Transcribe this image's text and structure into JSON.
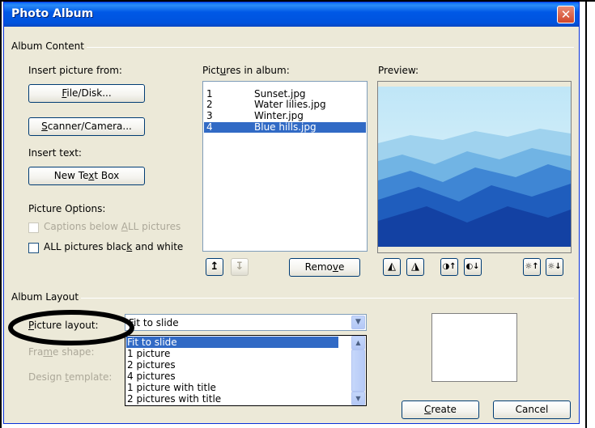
{
  "window": {
    "title": "Photo Album",
    "close_glyph": "✕"
  },
  "album_content": {
    "group_label": "Album Content",
    "insert_picture_from": "Insert picture from:",
    "file_disk_button": {
      "pre": "",
      "ul": "F",
      "post": "ile/Disk..."
    },
    "scanner_button": {
      "pre": "",
      "ul": "S",
      "post": "canner/Camera..."
    },
    "insert_text": "Insert text:",
    "new_text_box_button": {
      "pre": "New Te",
      "ul": "x",
      "post": "t Box"
    },
    "picture_options": "Picture Options:",
    "captions_checkbox": {
      "pre": "Captions below ",
      "ul": "A",
      "post": "LL pictures",
      "checked": false,
      "enabled": false
    },
    "bw_checkbox": {
      "pre": "ALL pictures blac",
      "ul": "k",
      "post": " and white",
      "checked": false,
      "enabled": true
    },
    "pictures_in_album": {
      "pre": "Pict",
      "ul": "u",
      "post": "res in album:"
    },
    "pictures": [
      {
        "index": "1",
        "name": "Sunset.jpg",
        "selected": false
      },
      {
        "index": "2",
        "name": "Water lilies.jpg",
        "selected": false
      },
      {
        "index": "3",
        "name": "Winter.jpg",
        "selected": false
      },
      {
        "index": "4",
        "name": "Blue hills.jpg",
        "selected": true
      }
    ],
    "remove_button": {
      "pre": "Remo",
      "ul": "v",
      "post": "e"
    },
    "preview_label": "Preview:"
  },
  "album_layout": {
    "group_label": "Album Layout",
    "picture_layout_label": {
      "pre": "",
      "ul": "P",
      "post": "icture layout:"
    },
    "picture_layout_value": "Fit to slide",
    "frame_shape_label": {
      "pre": "Fra",
      "ul": "m",
      "post": "e shape:"
    },
    "design_template_label": {
      "pre": "Design ",
      "ul": "t",
      "post": "emplate:"
    },
    "layout_options": [
      {
        "label": "Fit to slide",
        "selected": true
      },
      {
        "label": "1 picture",
        "selected": false
      },
      {
        "label": "2 pictures",
        "selected": false
      },
      {
        "label": "4 pictures",
        "selected": false
      },
      {
        "label": "1 picture with title",
        "selected": false
      },
      {
        "label": "2 pictures with title",
        "selected": false
      }
    ]
  },
  "footer": {
    "create_button": {
      "pre": "",
      "ul": "C",
      "post": "reate"
    },
    "cancel_button": "Cancel"
  },
  "icons": {
    "move_up": "↥",
    "move_down": "↧",
    "rotate_left": "◭",
    "rotate_right": "◮",
    "contrast_up": "◑↑",
    "contrast_down": "◐↓",
    "brightness_up": "☼↑",
    "brightness_down": "☼↓",
    "dropdown": "▼",
    "scroll_up": "▲",
    "scroll_down": "▼"
  },
  "colors": {
    "titlebar": "#0058e6",
    "dialog_bg": "#ece9d8",
    "selection": "#316ac5",
    "annotation": "#000000"
  }
}
